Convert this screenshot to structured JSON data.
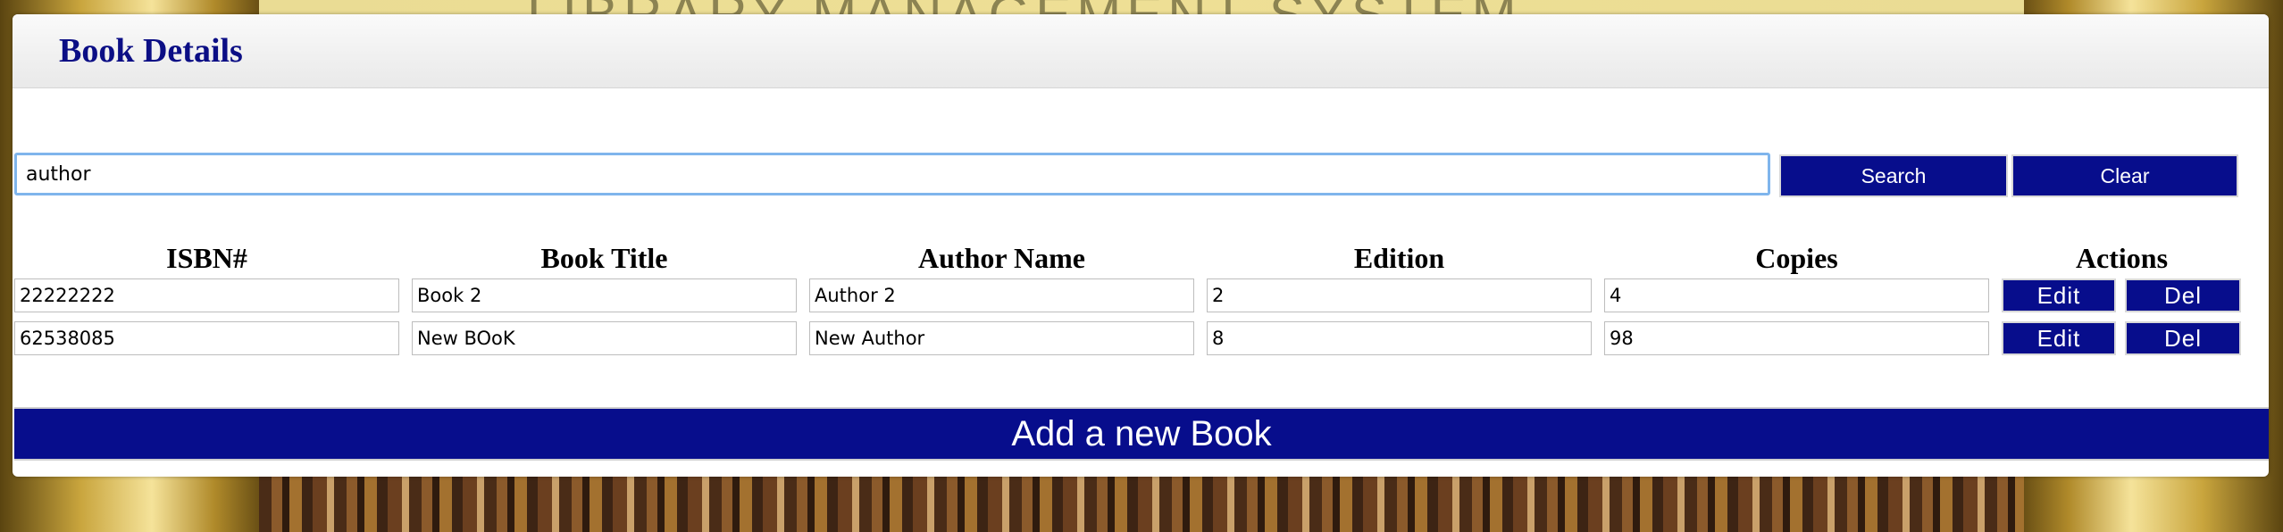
{
  "background": {
    "title_text": "LIBRARY MANAGEMENT SYSTEM"
  },
  "panel": {
    "title": "Book Details"
  },
  "search": {
    "value": "author",
    "search_label": "Search",
    "clear_label": "Clear"
  },
  "table": {
    "headers": [
      "ISBN#",
      "Book Title",
      "Author Name",
      "Edition",
      "Copies",
      "Actions"
    ],
    "rows": [
      {
        "isbn": "22222222",
        "title": "Book 2",
        "author": "Author 2",
        "edition": "2",
        "copies": "4"
      },
      {
        "isbn": "62538085",
        "title": "New BOoK",
        "author": "New Author",
        "edition": "8",
        "copies": "98"
      }
    ],
    "edit_label": "Edit",
    "del_label": "Del"
  },
  "add_button": {
    "label": "Add a new Book"
  },
  "colors": {
    "primary": "#070d8c",
    "title": "#0b0e85",
    "focus_border": "#7fb5ec"
  }
}
